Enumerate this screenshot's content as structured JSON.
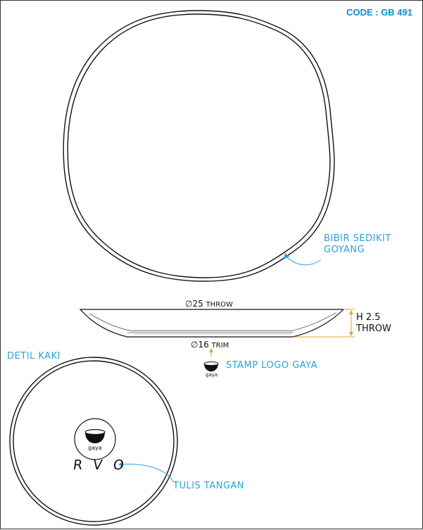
{
  "code": "CODE : GB 491",
  "notes": {
    "lip": [
      "BIBIR SEDIKIT",
      "GOYANG"
    ],
    "stamp": "STAMP LOGO GAYA",
    "foot_detail": "DETIL KAKI",
    "handwriting": "TULIS TANGAN"
  },
  "dimensions": {
    "top_diameter": "25",
    "top_diameter_unit": "THROW",
    "foot_diameter": "16",
    "foot_diameter_unit": "TRIM",
    "height": "H 2.5",
    "height_unit": "THROW"
  },
  "logo_label": "gaya",
  "handwritten_mark": "RVO",
  "colors": {
    "note": "#2aa3d8",
    "code": "#0a8fd0",
    "dimension_line": "#e0a030"
  }
}
